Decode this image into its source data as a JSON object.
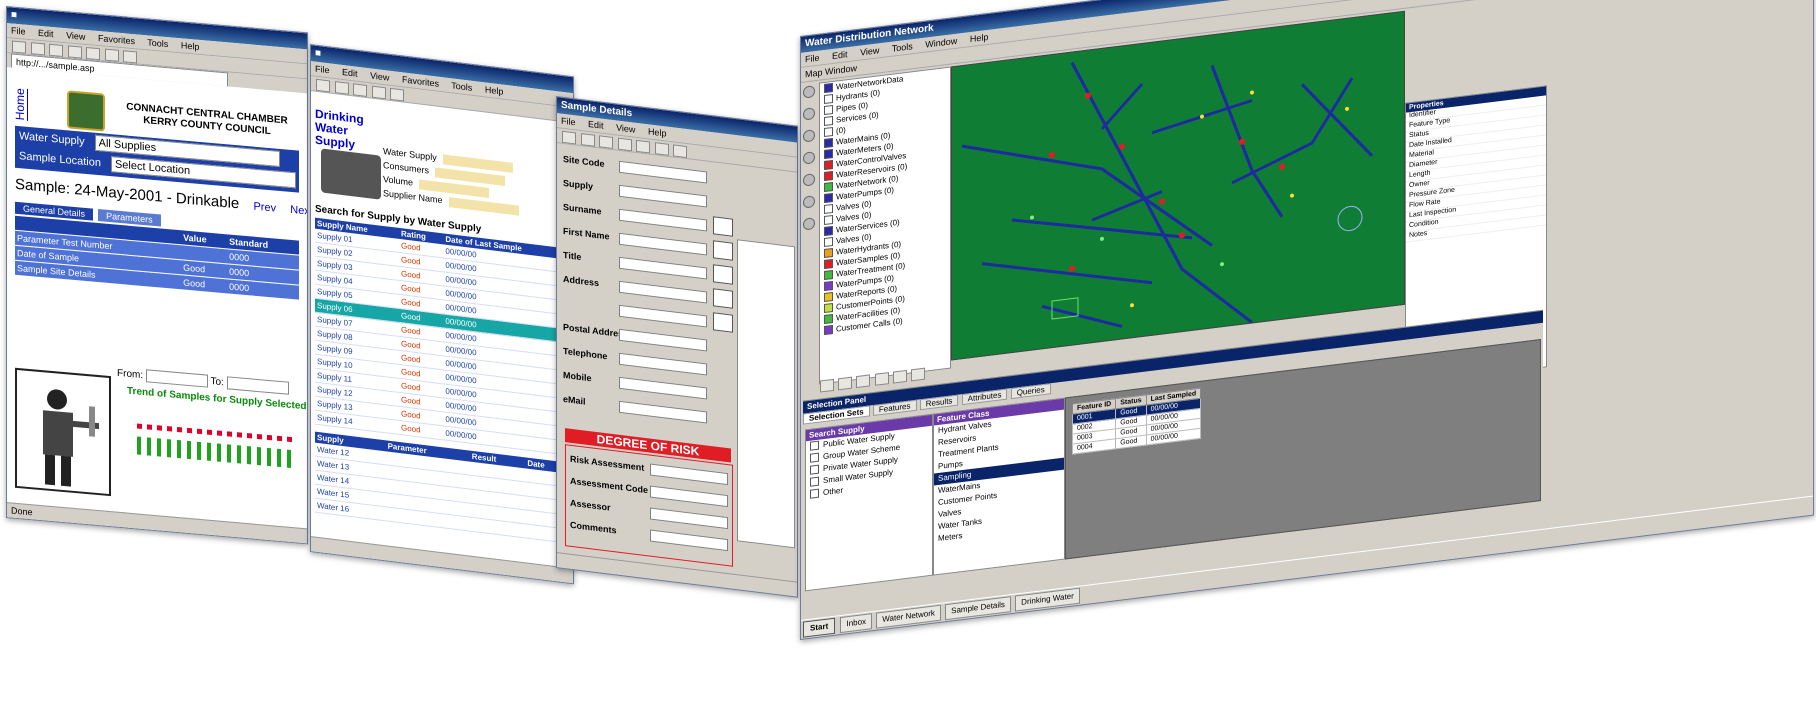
{
  "win1": {
    "menu": [
      "File",
      "Edit",
      "View",
      "Favorites",
      "Tools",
      "Help"
    ],
    "address": "http://.../sample.asp",
    "home_link": "Home",
    "org_lines": [
      "CONNACHT CENTRAL CHAMBER",
      "KERRY COUNTY COUNCIL"
    ],
    "form": {
      "row1_label": "Water Supply",
      "row1_value": "All Supplies",
      "row2_label": "Sample Location",
      "row2_value": "Select Location"
    },
    "sample_line": "Sample: 24-May-2001 - Drinkable",
    "links": [
      "Prev",
      "Next"
    ],
    "tabs": [
      "General Details",
      "Parameters"
    ],
    "table": {
      "headers": [
        "",
        "Value",
        "Standard"
      ],
      "rows": [
        [
          "Parameter Test Number",
          "",
          "0000"
        ],
        [
          "Date of Sample",
          "Good",
          "0000"
        ],
        [
          "Sample Site Details",
          "Good",
          "0000"
        ]
      ]
    },
    "filter": {
      "from_label": "From:",
      "to_label": "To:"
    },
    "plot_title": "Trend of Samples for Supply Selected",
    "status": "Done"
  },
  "win2": {
    "menu": [
      "File",
      "Edit",
      "View",
      "Favorites",
      "Tools",
      "Help"
    ],
    "heading": "Drinking Water Supply",
    "info": [
      {
        "label": "Water Supply",
        "value": ""
      },
      {
        "label": "Consumers",
        "value": ""
      },
      {
        "label": "Volume",
        "value": ""
      },
      {
        "label": "Supplier Name",
        "value": ""
      }
    ],
    "search_header": "Search for Supply by Water Supply",
    "grid": {
      "headers": [
        "Supply Name",
        "Rating",
        "Date of Last Sample"
      ],
      "rows": [
        [
          "Supply 01",
          "Good",
          "00/00/00"
        ],
        [
          "Supply 02",
          "Good",
          "00/00/00"
        ],
        [
          "Supply 03",
          "Good",
          "00/00/00"
        ],
        [
          "Supply 04",
          "Good",
          "00/00/00"
        ],
        [
          "Supply 05",
          "Good",
          "00/00/00"
        ],
        [
          "Supply 06",
          "Good",
          "00/00/00"
        ],
        [
          "Supply 07",
          "Good",
          "00/00/00"
        ],
        [
          "Supply 08",
          "Good",
          "00/00/00"
        ],
        [
          "Supply 09",
          "Good",
          "00/00/00"
        ],
        [
          "Supply 10",
          "Good",
          "00/00/00"
        ],
        [
          "Supply 11",
          "Good",
          "00/00/00"
        ],
        [
          "Supply 12",
          "Good",
          "00/00/00"
        ],
        [
          "Supply 13",
          "Good",
          "00/00/00"
        ],
        [
          "Supply 14",
          "Good",
          "00/00/00"
        ]
      ],
      "highlight_index": 5
    },
    "grid2": {
      "headers": [
        "Supply",
        "Parameter",
        "Result",
        "Date"
      ],
      "rows": [
        [
          "Water 12",
          "",
          "",
          ""
        ],
        [
          "Water 13",
          "",
          "",
          ""
        ],
        [
          "Water 14",
          "",
          "",
          ""
        ],
        [
          "Water 15",
          "",
          "",
          ""
        ],
        [
          "Water 16",
          "",
          "",
          ""
        ]
      ]
    }
  },
  "win3": {
    "title": "Sample Details",
    "menu": [
      "File",
      "Edit",
      "View",
      "Help"
    ],
    "fields": [
      {
        "label": "Site Code",
        "value": ""
      },
      {
        "label": "Supply",
        "value": ""
      },
      {
        "label": "Surname",
        "value": ""
      },
      {
        "label": "First Name",
        "value": ""
      },
      {
        "label": "Title",
        "value": ""
      },
      {
        "label": "Address",
        "value": ""
      },
      {
        "label": "",
        "value": ""
      },
      {
        "label": "Postal Address",
        "value": ""
      },
      {
        "label": "Telephone",
        "value": ""
      },
      {
        "label": "Mobile",
        "value": ""
      },
      {
        "label": "eMail",
        "value": ""
      }
    ],
    "risk_title": "DEGREE OF RISK",
    "risk_fields": [
      {
        "label": "Risk Assessment",
        "value": ""
      },
      {
        "label": "Assessment Code",
        "value": ""
      },
      {
        "label": "Assessor",
        "value": ""
      },
      {
        "label": "Comments",
        "value": ""
      }
    ],
    "side_icons": [
      "map-icon",
      "car-icon",
      "truck-icon",
      "cross-icon",
      "tool-icon"
    ]
  },
  "win4": {
    "title": "Water Distribution Network",
    "menu": [
      "File",
      "Edit",
      "View",
      "Tools",
      "Window",
      "Help"
    ],
    "panel_label": "Map Window",
    "tree": [
      {
        "label": "WaterNetworkData",
        "color": "#2a2aa8"
      },
      {
        "label": "Hydrants (0)",
        "color": "#ffffff"
      },
      {
        "label": "Pipes (0)",
        "color": "#ffffff"
      },
      {
        "label": "Services (0)",
        "color": "#ffffff"
      },
      {
        "label": "(0)",
        "color": "#ffffff"
      },
      {
        "label": "WaterMains (0)",
        "color": "#2a2aa8"
      },
      {
        "label": "WaterMeters (0)",
        "color": "#2a2aa8"
      },
      {
        "label": "WaterControlValves",
        "color": "#e01c24"
      },
      {
        "label": "WaterReservoirs (0)",
        "color": "#e01c24"
      },
      {
        "label": "WaterNetwork (0)",
        "color": "#3fb93f"
      },
      {
        "label": "WaterPumps (0)",
        "color": "#2a2aa8"
      },
      {
        "label": "Valves (0)",
        "color": "#ffffff"
      },
      {
        "label": "Valves (0)",
        "color": "#ffffff"
      },
      {
        "label": "WaterServices (0)",
        "color": "#2a2aa8"
      },
      {
        "label": "Valves (0)",
        "color": "#ffffff"
      },
      {
        "label": "WaterHydrants (0)",
        "color": "#e8a020"
      },
      {
        "label": "WaterSamples (0)",
        "color": "#e01c24"
      },
      {
        "label": "WaterTreatment (0)",
        "color": "#3fb93f"
      },
      {
        "label": "WaterPumps (0)",
        "color": "#7a3ac8"
      },
      {
        "label": "WaterReports (0)",
        "color": "#e8c020"
      },
      {
        "label": "CustomerPoints (0)",
        "color": "#c0e040"
      },
      {
        "label": "WaterFacilities (0)",
        "color": "#3fb93f"
      },
      {
        "label": "Customer Calls (0)",
        "color": "#7a3ac8"
      }
    ],
    "properties": {
      "header": "Properties",
      "rows": [
        "Identifier",
        "Feature Type",
        "Status",
        "Date Installed",
        "Material",
        "Diameter",
        "Length",
        "Owner",
        "Pressure Zone",
        "Flow Rate",
        "Last Inspection",
        "Condition",
        "Notes"
      ]
    },
    "bottom_title": "Selection Panel",
    "bottom_tabs": [
      "Selection Sets",
      "Features",
      "Results",
      "Attributes",
      "Queries"
    ],
    "panelA": {
      "header": "Search Supply",
      "items": [
        "Public Water Supply",
        "Group Water Scheme",
        "Private Water Supply",
        "Small Water Supply",
        "Other"
      ]
    },
    "panelB": {
      "header": "Feature Class",
      "items": [
        "Hydrant Valves",
        "Reservoirs",
        "Treatment Plants",
        "Pumps",
        "Sampling",
        "WaterMains",
        "Customer Points",
        "Valves",
        "Water Tanks",
        "Meters"
      ],
      "selected_index": 4
    },
    "panelC_table": {
      "headers": [
        "Feature ID",
        "Status",
        "Last Sampled"
      ],
      "rows": [
        [
          "0001",
          "Good",
          "00/00/00"
        ],
        [
          "0002",
          "Good",
          "00/00/00"
        ],
        [
          "0003",
          "Good",
          "00/00/00"
        ],
        [
          "0004",
          "Good",
          "00/00/00"
        ]
      ],
      "selected_index": 0
    },
    "taskbar": {
      "start": "Start",
      "tasks": [
        "Inbox",
        "Water Network",
        "Sample Details",
        "Drinking Water"
      ]
    }
  }
}
